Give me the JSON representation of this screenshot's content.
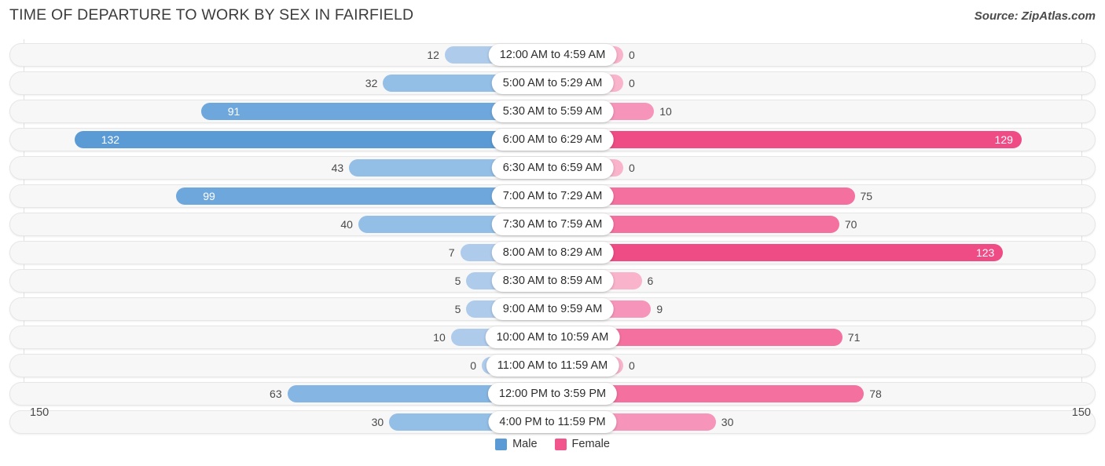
{
  "header": {
    "title": "TIME OF DEPARTURE TO WORK BY SEX IN FAIRFIELD",
    "source": "Source: ZipAtlas.com"
  },
  "axis": {
    "left_max": "150",
    "right_max": "150",
    "max_value": 150
  },
  "legend": {
    "items": [
      {
        "label": "Male",
        "color": "#5b9bd5"
      },
      {
        "label": "Female",
        "color": "#f2558c"
      }
    ]
  },
  "colors": {
    "male_strong": "#5b9bd5",
    "male_mid": "#7badde",
    "male_light": "#aecbec",
    "female_strong": "#ef4b85",
    "female_mid": "#f4runtime",
    "female_light": "#f9b3cb"
  },
  "chart_data": {
    "type": "bar",
    "title": "TIME OF DEPARTURE TO WORK BY SEX IN FAIRFIELD",
    "xlabel": "",
    "ylabel": "",
    "orientation": "horizontal-diverging",
    "xlim": [
      150,
      150
    ],
    "grid": true,
    "legend_position": "bottom",
    "categories": [
      "12:00 AM to 4:59 AM",
      "5:00 AM to 5:29 AM",
      "5:30 AM to 5:59 AM",
      "6:00 AM to 6:29 AM",
      "6:30 AM to 6:59 AM",
      "7:00 AM to 7:29 AM",
      "7:30 AM to 7:59 AM",
      "8:00 AM to 8:29 AM",
      "8:30 AM to 8:59 AM",
      "9:00 AM to 9:59 AM",
      "10:00 AM to 10:59 AM",
      "11:00 AM to 11:59 AM",
      "12:00 PM to 3:59 PM",
      "4:00 PM to 11:59 PM"
    ],
    "series": [
      {
        "name": "Male",
        "values": [
          12,
          32,
          91,
          132,
          43,
          99,
          40,
          7,
          5,
          5,
          10,
          0,
          63,
          30
        ]
      },
      {
        "name": "Female",
        "values": [
          0,
          0,
          10,
          129,
          0,
          75,
          70,
          123,
          6,
          9,
          71,
          0,
          78,
          30
        ]
      }
    ]
  },
  "rows": [
    {
      "label": "12:00 AM to 4:59 AM",
      "male": 12,
      "female": 0
    },
    {
      "label": "5:00 AM to 5:29 AM",
      "male": 32,
      "female": 0
    },
    {
      "label": "5:30 AM to 5:59 AM",
      "male": 91,
      "female": 10
    },
    {
      "label": "6:00 AM to 6:29 AM",
      "male": 132,
      "female": 129
    },
    {
      "label": "6:30 AM to 6:59 AM",
      "male": 43,
      "female": 0
    },
    {
      "label": "7:00 AM to 7:29 AM",
      "male": 99,
      "female": 75
    },
    {
      "label": "7:30 AM to 7:59 AM",
      "male": 40,
      "female": 70
    },
    {
      "label": "8:00 AM to 8:29 AM",
      "male": 7,
      "female": 123
    },
    {
      "label": "8:30 AM to 8:59 AM",
      "male": 5,
      "female": 6
    },
    {
      "label": "9:00 AM to 9:59 AM",
      "male": 5,
      "female": 9
    },
    {
      "label": "10:00 AM to 10:59 AM",
      "male": 10,
      "female": 71
    },
    {
      "label": "11:00 AM to 11:59 AM",
      "male": 0,
      "female": 0
    },
    {
      "label": "12:00 PM to 3:59 PM",
      "male": 63,
      "female": 78
    },
    {
      "label": "4:00 PM to 11:59 PM",
      "male": 30,
      "female": 30
    }
  ]
}
